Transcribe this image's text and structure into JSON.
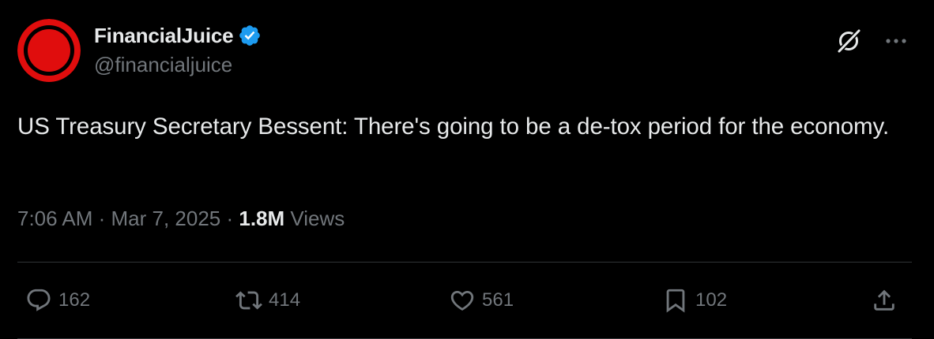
{
  "author": {
    "name": "FinancialJuice",
    "handle": "@financialjuice",
    "verified": true,
    "avatar_colors": {
      "ring": "#e00d0d",
      "gap": "#000000",
      "dot": "#e00d0d"
    },
    "verified_color": "#1d9bf0"
  },
  "header_icons": {
    "grok": "grok-icon",
    "more": "more-options-icon"
  },
  "tweet": {
    "text": "US Treasury Secretary Bessent: There's going to be a de-tox period for the economy."
  },
  "meta": {
    "time": "7:06 AM",
    "separator1": " · ",
    "date": "Mar 7, 2025",
    "separator2": " · ",
    "views_count": "1.8M",
    "views_label": " Views"
  },
  "actions": {
    "reply": {
      "icon": "reply-icon",
      "count": "162"
    },
    "repost": {
      "icon": "repost-icon",
      "count": "414"
    },
    "like": {
      "icon": "heart-icon",
      "count": "561"
    },
    "bookmark": {
      "icon": "bookmark-icon",
      "count": "102"
    },
    "share": {
      "icon": "share-icon"
    }
  },
  "colors": {
    "background": "#000000",
    "primary_text": "#e7e9ea",
    "secondary_text": "#71767b",
    "divider": "#2f3336"
  }
}
